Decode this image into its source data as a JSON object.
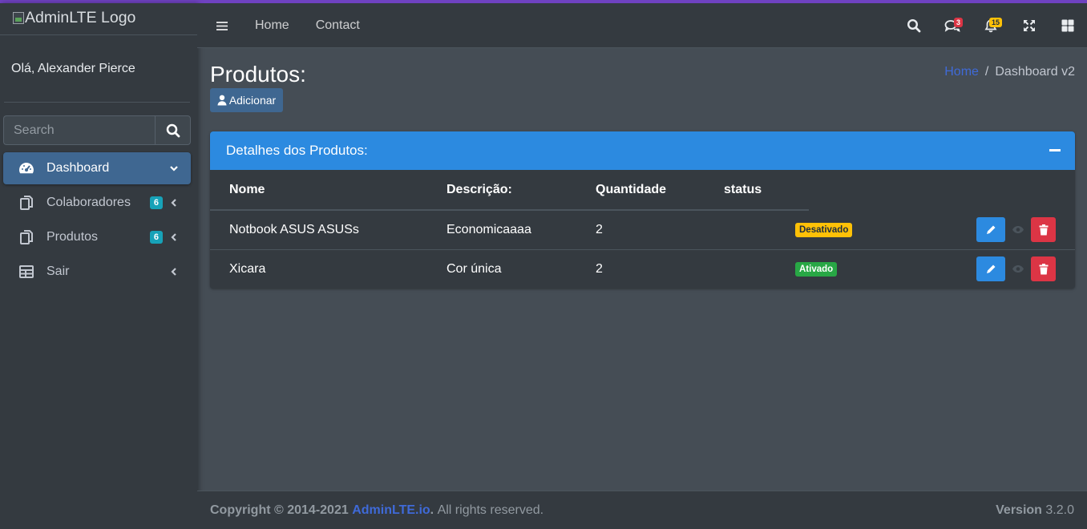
{
  "brand": {
    "logo_alt": "AdminLTE Logo"
  },
  "user": {
    "greeting": "Olá, Alexander Pierce"
  },
  "search": {
    "placeholder": "Search"
  },
  "sidebar": {
    "items": [
      {
        "label": "Dashboard",
        "icon": "tachometer-icon",
        "active": true,
        "badge": null
      },
      {
        "label": "Colaboradores",
        "icon": "copy-icon",
        "active": false,
        "badge": "6"
      },
      {
        "label": "Produtos",
        "icon": "copy-icon",
        "active": false,
        "badge": "6"
      },
      {
        "label": "Sair",
        "icon": "table-icon",
        "active": false,
        "badge": null
      }
    ]
  },
  "topbar": {
    "links": [
      "Home",
      "Contact"
    ],
    "messages_badge": "3",
    "notifications_badge": "15",
    "colors": {
      "messages_badge": "#dc3545",
      "notifications_badge": "#ffc107"
    }
  },
  "header": {
    "title": "Produtos:",
    "add_button": "Adicionar",
    "breadcrumb": {
      "home": "Home",
      "current": "Dashboard v2"
    }
  },
  "card": {
    "title": "Detalhes dos Produtos:",
    "columns": [
      "Nome",
      "Descrição:",
      "Quantidade",
      "status"
    ],
    "rows": [
      {
        "nome": "Notbook ASUS ASUSs",
        "descricao": "Economicaaaa",
        "quantidade": "2",
        "status": "Desativado"
      },
      {
        "nome": "Xicara",
        "descricao": "Cor única",
        "quantidade": "2",
        "status": "Ativado"
      }
    ]
  },
  "footer": {
    "copyright": "Copyright © 2014-2021",
    "link": "AdminLTE.io",
    "dot": ".",
    "rights": "All rights reserved.",
    "version_label": "Version",
    "version": "3.2.0"
  },
  "colors": {
    "accent": "#6f42c1",
    "primary": "#2c8ae0",
    "danger": "#dc3545",
    "success": "#28a745",
    "warning": "#ffc107"
  }
}
